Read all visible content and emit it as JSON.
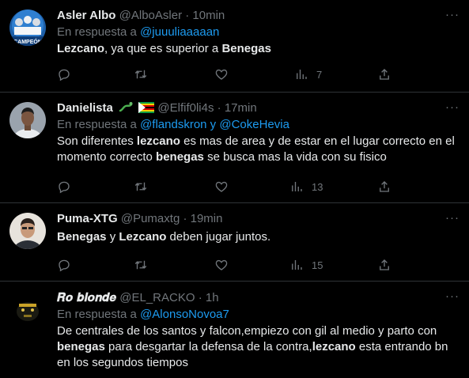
{
  "colors": {
    "background": "#000000",
    "text": "#e7e9ea",
    "muted": "#71767b",
    "link": "#1d9bf0",
    "border": "#2f3336"
  },
  "reply_prefix": "En respuesta a",
  "more_glyph": "···",
  "tweets": [
    {
      "name": "Asler Albo",
      "handle": "@AlboAsler",
      "sep": "·",
      "time": "10min",
      "reply_to": "@juuuliaaaaan",
      "text": {
        "p1": "Lezcano",
        "p2": ", ya que es superior a ",
        "p3": "Benegas"
      },
      "views": "7",
      "avatar_label": "CAMPEÓN"
    },
    {
      "name": "Danielista",
      "handle": "@Elfif0li4s",
      "sep": "·",
      "time": "17min",
      "reply_to": "@flandskron y @CokeHevia",
      "text": {
        "p1": "Son diferentes ",
        "p2": "lezcano",
        "p3": " es mas de area y de estar en el lugar correcto en el momento correcto ",
        "p4": "benegas",
        "p5": " se busca mas la vida con su fisico"
      },
      "views": "13"
    },
    {
      "name": "Puma-XTG",
      "handle": "@Pumaxtg",
      "sep": "·",
      "time": "19min",
      "text": {
        "p1": "Benegas",
        "p2": " y ",
        "p3": "Lezcano",
        "p4": " deben jugar juntos."
      },
      "views": "15"
    },
    {
      "name": "𝑹𝒐 𝒃𝒍𝒐𝒏𝒅𝒆",
      "handle": "@EL_RACKO",
      "sep": "·",
      "time": "1h",
      "reply_to": "@AlonsoNovoa7",
      "text": {
        "p1": "De centrales de los santos y falcon,empiezo con gil al medio y parto con ",
        "p2": "benegas",
        "p3": " para desgartar la defensa de la contra,",
        "p4": "lezcano",
        "p5": " esta entrando bn en los segundos tiempos"
      }
    }
  ]
}
